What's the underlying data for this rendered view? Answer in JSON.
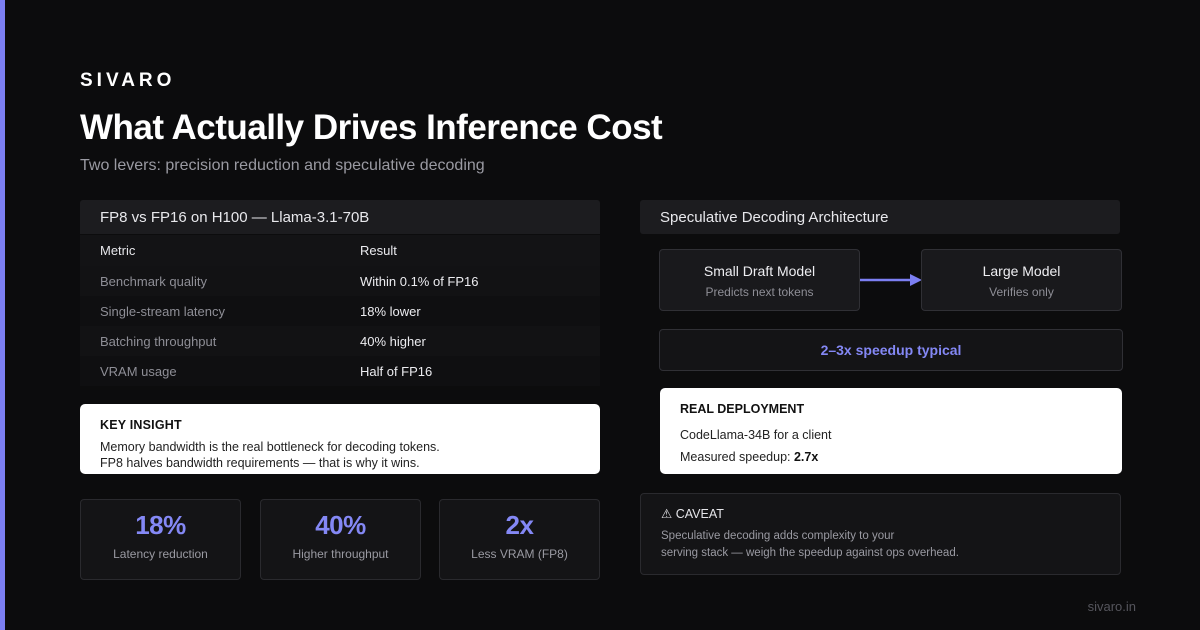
{
  "brand": "SIVARO",
  "title": "What Actually Drives Inference Cost",
  "subtitle": "Two levers: precision reduction and speculative decoding",
  "colors": {
    "accent": "#7c7ff2",
    "highlight": "#8488f5",
    "background": "#0c0c0d"
  },
  "comparison": {
    "heading": "FP8 vs FP16 on H100 — Llama-3.1-70B",
    "columns": [
      "Metric",
      "Result"
    ],
    "rows": [
      [
        "Benchmark quality",
        "Within 0.1% of FP16"
      ],
      [
        "Single-stream latency",
        "18% lower"
      ],
      [
        "Batching throughput",
        "40% higher"
      ],
      [
        "VRAM usage",
        "Half of FP16"
      ]
    ]
  },
  "insight": {
    "title": "KEY INSIGHT",
    "line1": "Memory bandwidth is the real bottleneck for decoding tokens.",
    "line2": "FP8 halves bandwidth requirements — that is why it wins."
  },
  "stats": [
    {
      "value": "18%",
      "label": "Latency reduction"
    },
    {
      "value": "40%",
      "label": "Higher throughput"
    },
    {
      "value": "2x",
      "label": "Less VRAM (FP8)"
    }
  ],
  "speculative": {
    "heading": "Speculative Decoding Architecture",
    "draft_model": {
      "name": "Small Draft Model",
      "desc": "Predicts next tokens"
    },
    "large_model": {
      "name": "Large Model",
      "desc": "Verifies only"
    },
    "arrow_icon": "arrow-right-icon",
    "speedup": "2–3x speedup typical"
  },
  "deployment": {
    "title": "REAL DEPLOYMENT",
    "line1": "CodeLlama-34B for a client",
    "line2_prefix": "Measured speedup:",
    "line2_value": "2.7x"
  },
  "caveat": {
    "icon": "warning-icon",
    "icon_glyph": "⚠",
    "title": "CAVEAT",
    "line1": "Speculative decoding adds complexity to your",
    "line2": "serving stack — weigh the speedup against ops overhead."
  },
  "footer": "sivaro.in"
}
